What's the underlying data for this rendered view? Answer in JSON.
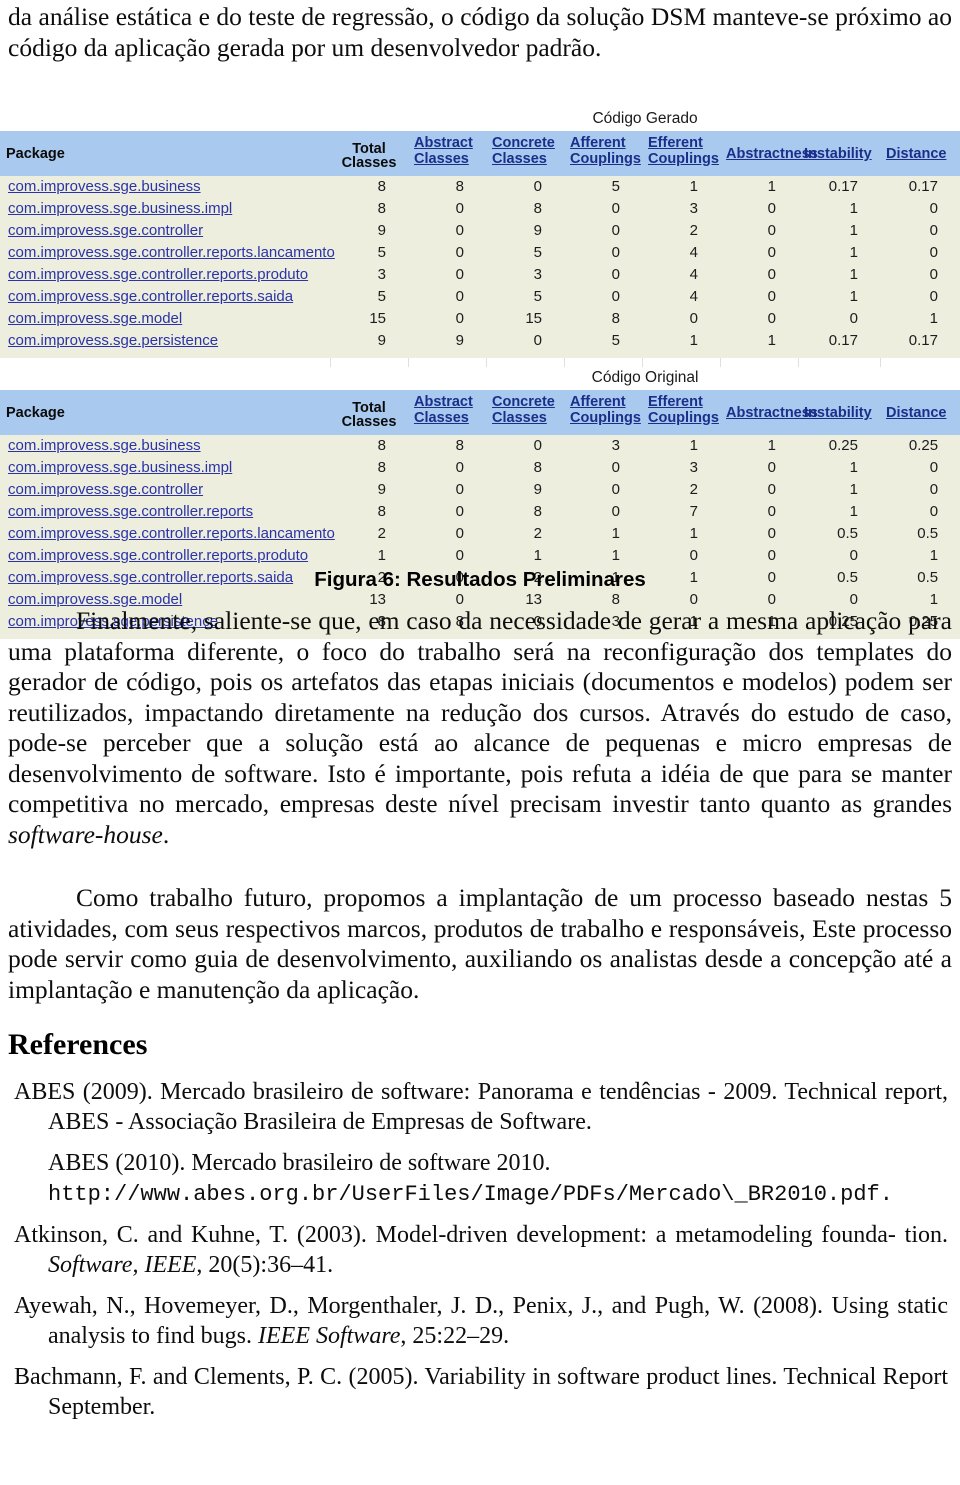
{
  "document": {
    "top_paragraph": "da análise estática e do teste de regressão, o código da solução DSM manteve-se próximo ao código da aplicação gerada por um desenvolvedor padrão.",
    "figure_caption": "Figura 6: Resultados Preliminares",
    "paragraph_1": "Finalmente, saliente-se que, em caso da necessidade de gerar a mesma aplicação para uma plataforma diferente, o foco do trabalho será na reconfiguração dos templates do gerador de código, pois os artefatos das etapas iniciais (documentos e modelos) podem ser reutilizados, impactando diretamente na redução dos cursos. Através do estudo de caso, pode-se perceber que a solução está ao alcance de pequenas e micro empresas de desenvolvimento de software. Isto é importante, pois refuta a idéia de que para se manter competitiva no mercado, empresas deste nível precisam investir tanto quanto as grandes ",
    "paragraph_1_italic": "software-house",
    "paragraph_1_end": ".",
    "paragraph_2": "Como trabalho futuro, propomos a implantação de um processo baseado nestas 5 atividades, com seus respectivos marcos, produtos de trabalho e responsáveis, Este processo pode servir como guia de desenvolvimento, auxiliando os analistas desde a concepção até a implantação e manutenção da aplicação.",
    "references_heading": "References"
  },
  "tables": [
    {
      "caption": "Código Gerado",
      "columns": [
        "Package",
        "Total Classes",
        "Abstract Classes",
        "Concrete Classes",
        "Afferent Couplings",
        "Efferent Couplings",
        "Abstractness",
        "Instability",
        "Distance"
      ],
      "rows": [
        {
          "package": "com.improvess.sge.business",
          "total_classes": "8",
          "abstract_classes": "8",
          "concrete_classes": "0",
          "afferent_couplings": "5",
          "efferent_couplings": "1",
          "abstractness": "1",
          "instability": "0.17",
          "distance": "0.17"
        },
        {
          "package": "com.improvess.sge.business.impl",
          "total_classes": "8",
          "abstract_classes": "0",
          "concrete_classes": "8",
          "afferent_couplings": "0",
          "efferent_couplings": "3",
          "abstractness": "0",
          "instability": "1",
          "distance": "0"
        },
        {
          "package": "com.improvess.sge.controller",
          "total_classes": "9",
          "abstract_classes": "0",
          "concrete_classes": "9",
          "afferent_couplings": "0",
          "efferent_couplings": "2",
          "abstractness": "0",
          "instability": "1",
          "distance": "0"
        },
        {
          "package": "com.improvess.sge.controller.reports.lancamento",
          "total_classes": "5",
          "abstract_classes": "0",
          "concrete_classes": "5",
          "afferent_couplings": "0",
          "efferent_couplings": "4",
          "abstractness": "0",
          "instability": "1",
          "distance": "0"
        },
        {
          "package": "com.improvess.sge.controller.reports.produto",
          "total_classes": "3",
          "abstract_classes": "0",
          "concrete_classes": "3",
          "afferent_couplings": "0",
          "efferent_couplings": "4",
          "abstractness": "0",
          "instability": "1",
          "distance": "0"
        },
        {
          "package": "com.improvess.sge.controller.reports.saida",
          "total_classes": "5",
          "abstract_classes": "0",
          "concrete_classes": "5",
          "afferent_couplings": "0",
          "efferent_couplings": "4",
          "abstractness": "0",
          "instability": "1",
          "distance": "0"
        },
        {
          "package": "com.improvess.sge.model",
          "total_classes": "15",
          "abstract_classes": "0",
          "concrete_classes": "15",
          "afferent_couplings": "8",
          "efferent_couplings": "0",
          "abstractness": "0",
          "instability": "0",
          "distance": "1"
        },
        {
          "package": "com.improvess.sge.persistence",
          "total_classes": "9",
          "abstract_classes": "9",
          "concrete_classes": "0",
          "afferent_couplings": "5",
          "efferent_couplings": "1",
          "abstractness": "1",
          "instability": "0.17",
          "distance": "0.17"
        }
      ]
    },
    {
      "caption": "Código Original",
      "columns": [
        "Package",
        "Total Classes",
        "Abstract Classes",
        "Concrete Classes",
        "Afferent Couplings",
        "Efferent Couplings",
        "Abstractness",
        "Instability",
        "Distance"
      ],
      "rows": [
        {
          "package": "com.improvess.sge.business",
          "total_classes": "8",
          "abstract_classes": "8",
          "concrete_classes": "0",
          "afferent_couplings": "3",
          "efferent_couplings": "1",
          "abstractness": "1",
          "instability": "0.25",
          "distance": "0.25"
        },
        {
          "package": "com.improvess.sge.business.impl",
          "total_classes": "8",
          "abstract_classes": "0",
          "concrete_classes": "8",
          "afferent_couplings": "0",
          "efferent_couplings": "3",
          "abstractness": "0",
          "instability": "1",
          "distance": "0"
        },
        {
          "package": "com.improvess.sge.controller",
          "total_classes": "9",
          "abstract_classes": "0",
          "concrete_classes": "9",
          "afferent_couplings": "0",
          "efferent_couplings": "2",
          "abstractness": "0",
          "instability": "1",
          "distance": "0"
        },
        {
          "package": "com.improvess.sge.controller.reports",
          "total_classes": "8",
          "abstract_classes": "0",
          "concrete_classes": "8",
          "afferent_couplings": "0",
          "efferent_couplings": "7",
          "abstractness": "0",
          "instability": "1",
          "distance": "0"
        },
        {
          "package": "com.improvess.sge.controller.reports.lancamento",
          "total_classes": "2",
          "abstract_classes": "0",
          "concrete_classes": "2",
          "afferent_couplings": "1",
          "efferent_couplings": "1",
          "abstractness": "0",
          "instability": "0.5",
          "distance": "0.5"
        },
        {
          "package": "com.improvess.sge.controller.reports.produto",
          "total_classes": "1",
          "abstract_classes": "0",
          "concrete_classes": "1",
          "afferent_couplings": "1",
          "efferent_couplings": "0",
          "abstractness": "0",
          "instability": "0",
          "distance": "1"
        },
        {
          "package": "com.improvess.sge.controller.reports.saida",
          "total_classes": "2",
          "abstract_classes": "0",
          "concrete_classes": "2",
          "afferent_couplings": "1",
          "efferent_couplings": "1",
          "abstractness": "0",
          "instability": "0.5",
          "distance": "0.5"
        },
        {
          "package": "com.improvess.sge.model",
          "total_classes": "13",
          "abstract_classes": "0",
          "concrete_classes": "13",
          "afferent_couplings": "8",
          "efferent_couplings": "0",
          "abstractness": "0",
          "instability": "0",
          "distance": "1"
        },
        {
          "package": "com.improvess.sge.persistence",
          "total_classes": "8",
          "abstract_classes": "8",
          "concrete_classes": "0",
          "afferent_couplings": "3",
          "efferent_couplings": "1",
          "abstractness": "1",
          "instability": "0.25",
          "distance": "0.25"
        }
      ]
    }
  ],
  "references": [
    {
      "id": "abes-2009",
      "text": "ABES (2009). Mercado brasileiro de software: Panorama e tendências - 2009. Technical report, ABES - Associação Brasileira de Empresas de Software."
    },
    {
      "id": "abes-2010",
      "lead": "ABES (2010). Mercado brasileiro de software 2010.",
      "url": "http://www.abes.org.br/UserFiles/Image/PDFs/Mercado\\_BR2010.pdf."
    },
    {
      "id": "atkinson-kuhne-2003",
      "pre": "Atkinson, C. and Kuhne, T. (2003). Model-driven development: a metamodeling founda- tion. ",
      "italic": "Software, IEEE",
      "post": ", 20(5):36–41."
    },
    {
      "id": "ayewah-2008",
      "pre": "Ayewah, N., Hovemeyer, D., Morgenthaler, J. D., Penix, J., and Pugh, W. (2008). Using static analysis to find bugs. ",
      "italic": "IEEE Software",
      "post": ", 25:22–29."
    },
    {
      "id": "bachmann-clements-2005",
      "text": "Bachmann, F. and Clements, P. C. (2005). Variability in software product lines. Technical Report September."
    }
  ],
  "colors": {
    "header_background": "#a9c9ef",
    "row_background": "#edeede",
    "link": "#2b33a8",
    "header_link": "#1b2f8a",
    "page_background": "#ffffff"
  }
}
